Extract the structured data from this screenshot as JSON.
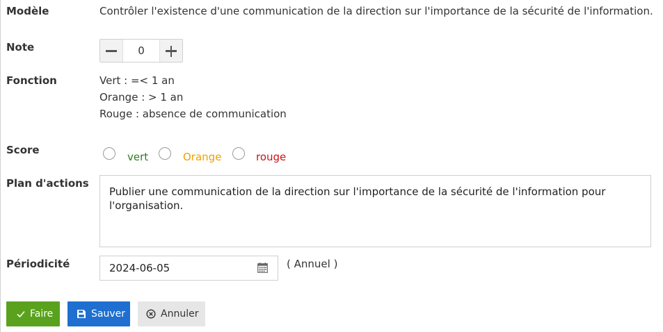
{
  "fields": {
    "modele": {
      "label": "Modèle",
      "value": "Contrôler l'existence d'une communication de la direction sur l'importance de la sécurité de l'information."
    },
    "note": {
      "label": "Note",
      "value": "0"
    },
    "fonction": {
      "label": "Fonction",
      "lines": [
        "Vert : =< 1 an",
        "Orange : > 1 an",
        "Rouge : absence de communication"
      ]
    },
    "score": {
      "label": "Score",
      "options": [
        {
          "label": "vert",
          "color": "#2e7d1f"
        },
        {
          "label": "Orange",
          "color": "#f0a000"
        },
        {
          "label": "rouge",
          "color": "#d01010"
        }
      ]
    },
    "plan": {
      "label": "Plan d'actions",
      "value": "Publier une communication de la direction sur l'importance de la sécurité de l'information pour l'organisation."
    },
    "periodicite": {
      "label": "Périodicité",
      "value": "2024-06-05",
      "suffix": "( Annuel )"
    }
  },
  "buttons": {
    "faire": {
      "label": "Faire",
      "icon": "check-icon",
      "color": "#5aa21d"
    },
    "sauver": {
      "label": "Sauver",
      "icon": "save-icon",
      "color": "#1e6fd0"
    },
    "annuler": {
      "label": "Annuler",
      "icon": "close-circle-icon",
      "color": "#e6e6e6"
    }
  }
}
